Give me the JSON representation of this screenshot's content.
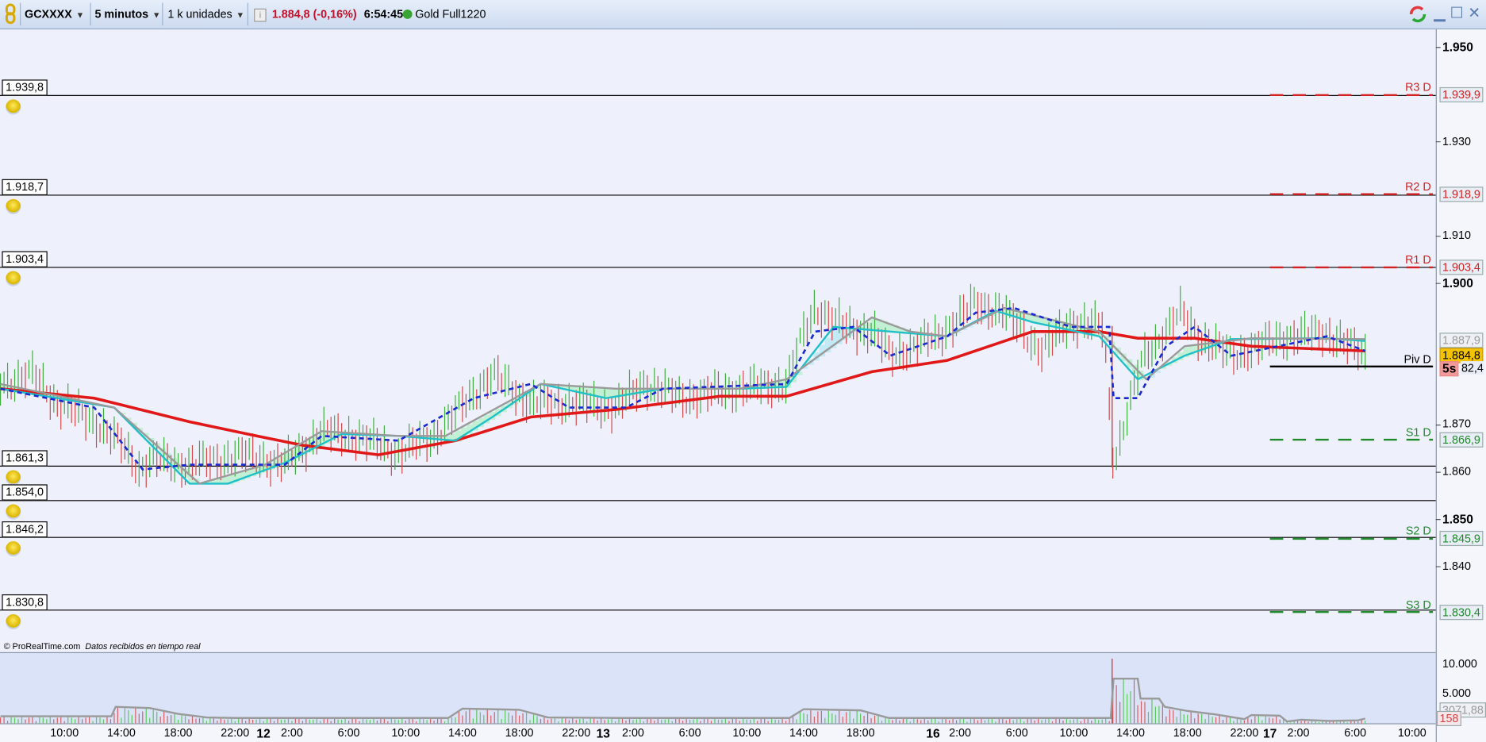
{
  "toolbar": {
    "symbol": "GCXXXX",
    "timeframe": "5 minutos",
    "units": "1 k unidades",
    "price": "1.884,8 (-0,16%)",
    "time": "6:54:45",
    "instrument": "Gold Full1220",
    "status_color": "#3aa336"
  },
  "footer": {
    "copyright": "© ProRealTime.com",
    "realtime": "Datos recibidos en tiempo real"
  },
  "alerts": [
    {
      "label": "1.939,8",
      "price": 1939.8
    },
    {
      "label": "1.918,7",
      "price": 1918.7
    },
    {
      "label": "1.903,4",
      "price": 1903.4
    },
    {
      "label": "1.861,3",
      "price": 1861.3
    },
    {
      "label": "1.854,0",
      "price": 1854.0
    },
    {
      "label": "1.846,2",
      "price": 1846.2
    },
    {
      "label": "1.830,8",
      "price": 1830.8
    }
  ],
  "chart_data": {
    "type": "line",
    "title": "GCXXXX 5 minutos",
    "ylim": [
      1825,
      1955
    ],
    "y_ticks": [
      {
        "label": "1.950",
        "v": 1950,
        "bold": true
      },
      {
        "label": "1.930",
        "v": 1930
      },
      {
        "label": "1.910",
        "v": 1910
      },
      {
        "label": "1.900",
        "v": 1900,
        "bold": true
      },
      {
        "label": "1.870",
        "v": 1870
      },
      {
        "label": "1.860",
        "v": 1860
      },
      {
        "label": "1.850",
        "v": 1850,
        "bold": true
      },
      {
        "label": "1.840",
        "v": 1840
      }
    ],
    "x_unit": "hours from 10:00 day 11",
    "x_ticks": [
      {
        "label": "10:00",
        "h": 0
      },
      {
        "label": "14:00",
        "h": 4
      },
      {
        "label": "18:00",
        "h": 8
      },
      {
        "label": "22:00",
        "h": 12
      },
      {
        "label": "12",
        "h": 14,
        "bold": true
      },
      {
        "label": "2:00",
        "h": 16
      },
      {
        "label": "6:00",
        "h": 20
      },
      {
        "label": "10:00",
        "h": 24
      },
      {
        "label": "14:00",
        "h": 28
      },
      {
        "label": "18:00",
        "h": 32
      },
      {
        "label": "22:00",
        "h": 36
      },
      {
        "label": "13",
        "h": 37.9,
        "bold": true
      },
      {
        "label": "2:00",
        "h": 40
      },
      {
        "label": "6:00",
        "h": 44
      },
      {
        "label": "10:00",
        "h": 48
      },
      {
        "label": "14:00",
        "h": 52
      },
      {
        "label": "18:00",
        "h": 56
      },
      {
        "label": "16",
        "h": 61.1,
        "bold": true
      },
      {
        "label": "2:00",
        "h": 63
      },
      {
        "label": "6:00",
        "h": 67
      },
      {
        "label": "10:00",
        "h": 71
      },
      {
        "label": "14:00",
        "h": 75
      },
      {
        "label": "18:00",
        "h": 79
      },
      {
        "label": "22:00",
        "h": 83
      },
      {
        "label": "17",
        "h": 84.8,
        "bold": true
      },
      {
        "label": "2:00",
        "h": 86.8
      },
      {
        "label": "6:00",
        "h": 90.8
      },
      {
        "label": "10:00",
        "h": 94.8
      }
    ],
    "series": [
      {
        "name": "Price",
        "color": "#5a8f4a",
        "x": [
          -4.5,
          -2.2,
          -0.5,
          2.1,
          4.1,
          5.3,
          6.1,
          8.8,
          12.8,
          15.5,
          18.1,
          20.8,
          23.5,
          26.1,
          28.8,
          30.1,
          32.8,
          35.5,
          38.8,
          40.8,
          43.5,
          47.5,
          50.8,
          51.8,
          52.8,
          54.8,
          56.8,
          58.1,
          61.5,
          64.1,
          66.1,
          68.8,
          70.8,
          73.1,
          73.8,
          74.5,
          75.8,
          78.5,
          79.8,
          82.1,
          86.1,
          88.8,
          91.5
        ],
        "y": [
          1878.7,
          1880.7,
          1874.7,
          1870.7,
          1865.7,
          1860.6,
          1862.6,
          1861.6,
          1863.7,
          1861.6,
          1868.7,
          1867.3,
          1864.1,
          1867.7,
          1876.7,
          1880.7,
          1874.7,
          1874.7,
          1873.7,
          1878.7,
          1875.7,
          1877.7,
          1878.7,
          1887.8,
          1894.8,
          1890.8,
          1889.8,
          1884.7,
          1888.8,
          1895.8,
          1893.8,
          1885.7,
          1891.8,
          1890.8,
          1861.6,
          1869.7,
          1883.7,
          1893.8,
          1888.8,
          1884.7,
          1888.8,
          1889.4,
          1884.8
        ]
      },
      {
        "name": "MA long",
        "color": "#e01818",
        "x": [
          -4.5,
          2.1,
          8.8,
          13.5,
          16.8,
          22.1,
          27.5,
          32.8,
          38.8,
          46.1,
          50.8,
          56.8,
          62.1,
          68.1,
          72.8,
          75.5,
          79.5,
          83.5,
          91.5
        ],
        "y": [
          1877.7,
          1875.7,
          1870.7,
          1867.7,
          1865.7,
          1863.7,
          1866.7,
          1871.7,
          1873.3,
          1876.1,
          1876.1,
          1881.3,
          1883.7,
          1889.8,
          1889.8,
          1888.4,
          1888.4,
          1886.7,
          1885.7
        ]
      },
      {
        "name": "MA cyan",
        "color": "#20c0c8",
        "x": [
          -4.5,
          3.5,
          8.8,
          11.5,
          15.5,
          19.5,
          23.5,
          27.5,
          30.1,
          33.5,
          38.1,
          42.1,
          47.5,
          50.8,
          54.1,
          58.1,
          62.1,
          65.5,
          68.1,
          72.8,
          75.5,
          78.8,
          82.1,
          88.8,
          91.5
        ],
        "y": [
          1877.7,
          1873.7,
          1857.6,
          1857.6,
          1862.0,
          1868.1,
          1867.7,
          1866.7,
          1871.7,
          1878.7,
          1875.7,
          1877.7,
          1877.7,
          1878.1,
          1890.8,
          1889.8,
          1888.8,
          1894.2,
          1891.8,
          1888.8,
          1879.7,
          1884.7,
          1888.2,
          1888.4,
          1887.8
        ]
      },
      {
        "name": "MA gray",
        "color": "#9a9a9a",
        "x": [
          -4.5,
          3.5,
          9.5,
          14.1,
          18.1,
          23.5,
          26.8,
          33.5,
          38.8,
          47.5,
          50.8,
          56.8,
          59.5,
          62.1,
          66.1,
          68.8,
          72.8,
          76.1,
          78.8,
          83.5,
          91.5
        ],
        "y": [
          1878.7,
          1873.7,
          1857.6,
          1861.6,
          1868.7,
          1867.7,
          1867.7,
          1878.7,
          1877.7,
          1877.7,
          1879.7,
          1892.8,
          1889.8,
          1888.8,
          1894.8,
          1892.8,
          1889.8,
          1879.7,
          1886.7,
          1888.4,
          1888.2
        ]
      },
      {
        "name": "MA dashed",
        "color": "#1a2ad0",
        "dashed": true,
        "x": [
          -4.5,
          2.1,
          5.5,
          8.8,
          15.5,
          18.1,
          23.5,
          28.8,
          32.8,
          35.5,
          39.5,
          42.1,
          50.8,
          52.8,
          55.5,
          58.1,
          62.1,
          64.1,
          66.8,
          70.8,
          73.5,
          73.8,
          75.5,
          77.5,
          79.5,
          82.1,
          88.8,
          91.5
        ],
        "y": [
          1877.7,
          1873.7,
          1860.6,
          1861.6,
          1861.6,
          1867.7,
          1866.7,
          1875.7,
          1878.7,
          1873.7,
          1873.7,
          1877.7,
          1878.7,
          1889.8,
          1890.8,
          1884.7,
          1888.8,
          1893.8,
          1894.8,
          1890.8,
          1890.8,
          1875.7,
          1875.7,
          1886.7,
          1890.8,
          1884.7,
          1888.8,
          1885.7
        ]
      }
    ],
    "pivots": [
      {
        "label": "R3 D",
        "value": 1939.9,
        "box": "1.939,9",
        "color": "#d42020",
        "dashed": true
      },
      {
        "label": "R2 D",
        "value": 1918.9,
        "box": "1.918,9",
        "color": "#d42020",
        "dashed": true
      },
      {
        "label": "R1 D",
        "value": 1903.4,
        "box": "1.903,4",
        "color": "#d42020",
        "dashed": true
      },
      {
        "label": "Piv D",
        "value": 1882.4,
        "box": "82,4",
        "color": "#000000",
        "dashed": false
      },
      {
        "label": "S1 D",
        "value": 1866.9,
        "box": "1.866,9",
        "color": "#1e8a2a",
        "dashed": true
      },
      {
        "label": "S2 D",
        "value": 1845.9,
        "box": "1.845,9",
        "color": "#1e8a2a",
        "dashed": true
      },
      {
        "label": "S3 D",
        "value": 1830.4,
        "box": "1.830,4",
        "color": "#1e8a2a",
        "dashed": true
      }
    ],
    "last_price": {
      "box": "1.884,8",
      "value": 1884.8,
      "color": "#f5c400"
    },
    "ma_box": "1.887,9",
    "countdown": "5s",
    "volume": {
      "ylim": [
        0,
        12000
      ],
      "ticks": [
        {
          "label": "10.000",
          "v": 10000
        },
        {
          "label": "5.000",
          "v": 5000
        }
      ],
      "avg_x": [
        -4.5,
        3.3,
        3.6,
        6.0,
        8.0,
        10.0,
        12.0,
        27.0,
        28.0,
        32.0,
        34.0,
        39.0,
        51.0,
        52.0,
        56.0,
        58.0,
        73.6,
        73.8,
        75.5,
        75.7,
        77.0,
        77.4,
        79.0,
        81.0,
        83.0,
        83.5,
        85.5,
        86.0,
        87.0,
        89.0,
        91.0,
        91.5
      ],
      "avg_y": [
        1200,
        1200,
        2800,
        2600,
        1600,
        1000,
        900,
        900,
        2500,
        2300,
        1000,
        900,
        900,
        2400,
        2200,
        900,
        900,
        7600,
        7600,
        4200,
        4200,
        2800,
        2100,
        1500,
        700,
        1400,
        1300,
        300,
        600,
        400,
        500,
        800
      ],
      "avg_box": "3071,88",
      "last_box": "158"
    }
  }
}
